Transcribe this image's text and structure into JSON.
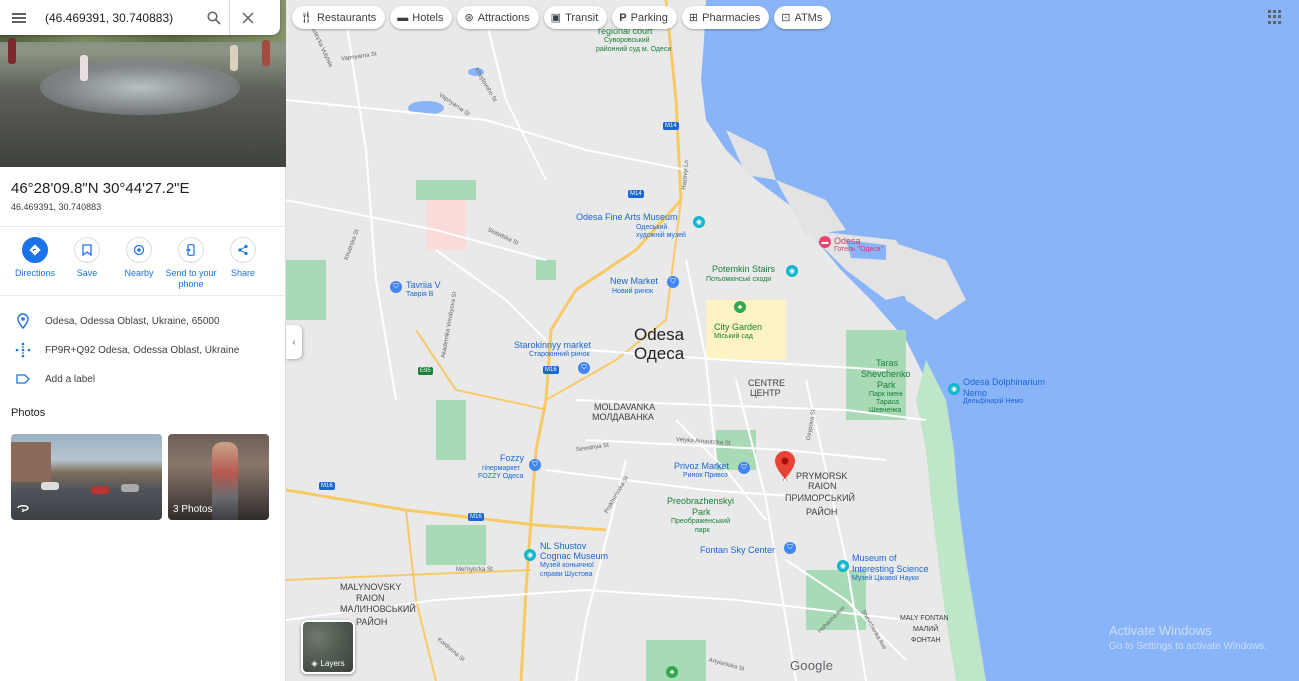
{
  "search": {
    "value": "(46.469391, 30.740883)"
  },
  "place": {
    "title": "46°28'09.8\"N 30°44'27.2\"E",
    "subtitle": "46.469391, 30.740883"
  },
  "actions": [
    {
      "label": "Directions"
    },
    {
      "label": "Save"
    },
    {
      "label": "Nearby"
    },
    {
      "label": "Send to your phone"
    },
    {
      "label": "Share"
    }
  ],
  "info": {
    "address": "Odesa, Odessa Oblast, Ukraine, 65000",
    "pluscode": "FP9R+Q92 Odesa, Odessa Oblast, Ukraine",
    "label": "Add a label"
  },
  "photos": {
    "title": "Photos",
    "count_label": "3 Photos"
  },
  "chips": [
    {
      "label": "Restaurants"
    },
    {
      "label": "Hotels"
    },
    {
      "label": "Attractions"
    },
    {
      "label": "Transit"
    },
    {
      "label": "Parking"
    },
    {
      "label": "Pharmacies"
    },
    {
      "label": "ATMs"
    }
  ],
  "map": {
    "city_en": "Odesa",
    "city_uk": "Одеса",
    "places": {
      "regional_court": "regional court",
      "regional_court_uk1": "Суворовський",
      "regional_court_uk2": "районний суд м. Одеси",
      "fine_arts": "Odesa Fine Arts Museum",
      "fine_arts_uk": "Одеський художній музей",
      "odesa_hotel": "Odesa",
      "odesa_hotel_uk": "Готель \"Одеса\"",
      "new_market": "New Market",
      "new_market_uk": "Новий ринок",
      "potemkin": "Potemkin Stairs",
      "potemkin_uk": "Потьомкінські сходи",
      "tavriia": "Tavriia V",
      "tavriia_uk": "Таврія В",
      "city_garden": "City Garden",
      "city_garden_uk": "Міський сад",
      "starokinnyy": "Starokinnyy market",
      "starokinnyy_uk": "Старокінний ринок",
      "centre": "CENTRE",
      "centre_uk": "ЦЕНТР",
      "moldavanka": "MOLDAVANKA",
      "moldavanka_uk": "МОЛДАВАНКА",
      "shevchenko1": "Taras",
      "shevchenko2": "Shevchenko",
      "shevchenko3": "Park",
      "shevchenko_uk1": "Парк імені",
      "shevchenko_uk2": "Тараса",
      "shevchenko_uk3": "Шевченка",
      "dolphinarium": "Odesa Dolphinarium",
      "dolphinarium2": "Nemo",
      "dolphinarium_uk": "Дельфінарій Немо",
      "fozzy": "Fozzy",
      "fozzy_uk1": "гіпермаркет",
      "fozzy_uk2": "FOZZY Одеса",
      "privoz": "Privoz Market",
      "privoz_uk": "Ринок Привоз",
      "prymorsk1": "PRYMORSK",
      "prymorsk2": "RAION",
      "prymorsk_uk1": "ПРИМОРСЬКИЙ",
      "prymorsk_uk2": "РАЙОН",
      "preobrazhenskyi1": "Preobrazhenskyi",
      "preobrazhenskyi2": "Park",
      "preobrazhenskyi_uk1": "Преображенський",
      "preobrazhenskyi_uk2": "парк",
      "fontan": "Fontan Sky Center",
      "shustov1": "NL Shustov",
      "shustov2": "Cognac Museum",
      "shustov_uk1": "Музей коньячної",
      "shustov_uk2": "справи Шустова",
      "museum_sci1": "Museum of",
      "museum_sci2": "Interesting Science",
      "museum_sci_uk": "Музей Цікавої Науки",
      "malynovskyi1": "MALYNOVSKY",
      "malynovskyi2": "RAION",
      "malynovskyi_uk1": "МАЛИНОВСЬКИЙ",
      "malynovskyi_uk2": "РАЙОН",
      "maly_fontan1": "MALY FONTAN",
      "maly_fontan2": "МАЛИЙ",
      "maly_fontan3": "ФОНТАН"
    },
    "streets": {
      "vapnyarna1": "Vapnyarna St",
      "vapnyarna2": "Vapnyarna St",
      "khvylovoho": "Khvylovoho St",
      "slobidska": "Slobidska St",
      "khutirska": "Khutirska St",
      "vulytsya": "Khutirs'ka Vulytsia",
      "akademika": "Akademika Vorobyova St",
      "serednya": "Serednya St",
      "velyka": "Velyka Arnauts'ka St",
      "prokhorivska": "Prokhorivska St",
      "melnytska": "Mel'nyts'ka St",
      "kordonna": "Kordonna St",
      "artyleriiska": "Artyleriiska St",
      "haharina": "Haharina Ave",
      "shevchenka_ave": "Shevchenka Ave",
      "osypova": "Osypova St",
      "hazovyi": "Hazovyi Ln"
    },
    "roads": {
      "m14a": "M14",
      "m14b": "M14",
      "m16a": "M16",
      "m16b": "M16",
      "m16c": "M16",
      "e95": "E95"
    }
  },
  "layers_label": "Layers",
  "google_logo": "Google",
  "watermark": {
    "line1": "Activate Windows",
    "line2": "Go to Settings to activate Windows."
  }
}
